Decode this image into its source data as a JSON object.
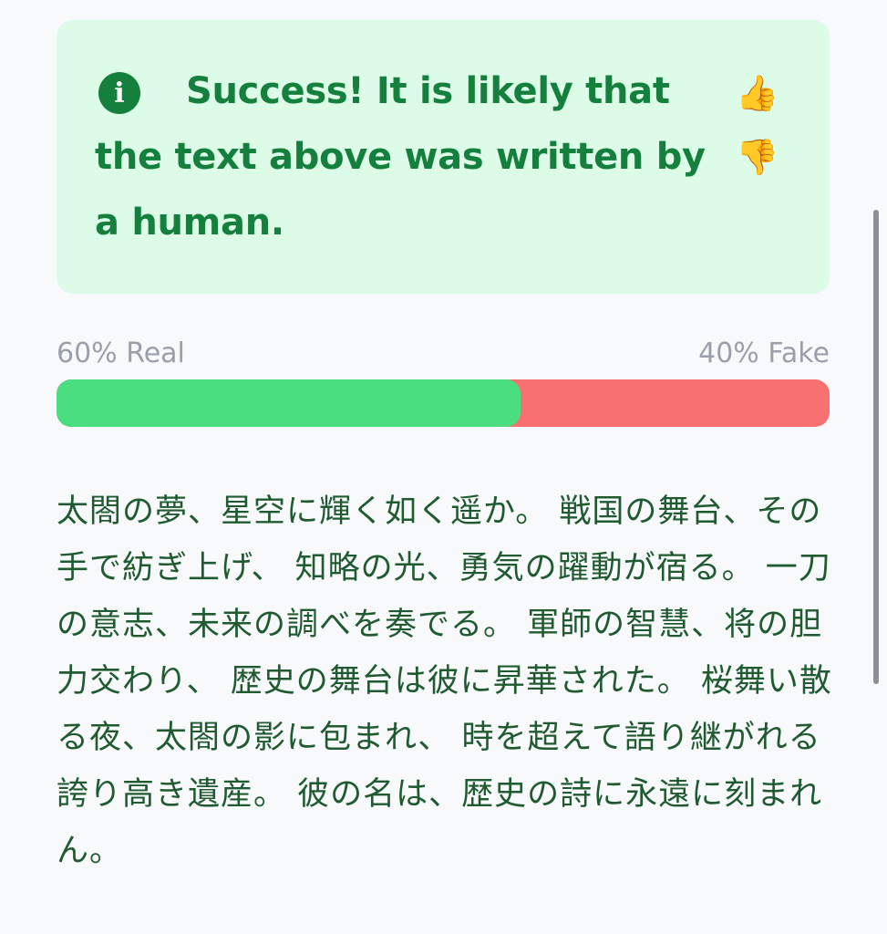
{
  "alert": {
    "message": "Success! It is likely that the text above was written by a human.",
    "icon": "info-icon",
    "icon_glyph": "i",
    "thumbs_up": "👍",
    "thumbs_down": "👎",
    "background": "#dcfce7",
    "text_color": "#15803d"
  },
  "result": {
    "real_label": "60% Real",
    "fake_label": "40% Fake",
    "real_fraction": 0.6,
    "real_color": "#4ade80",
    "fake_color": "#f87171"
  },
  "text": {
    "content": "太閤の夢、星空に輝く如く遥か。 戦国の舞台、その手で紡ぎ上げ、 知略の光、勇気の躍動が宿る。 一刀の意志、未来の調べを奏でる。 軍師の智慧、将の胆力交わり、 歴史の舞台は彼に昇華された。 桜舞い散る夜、太閤の影に包まれ、 時を超えて語り継がれる誇り高き遺産。 彼の名は、歴史の詩に永遠に刻まれん。"
  }
}
